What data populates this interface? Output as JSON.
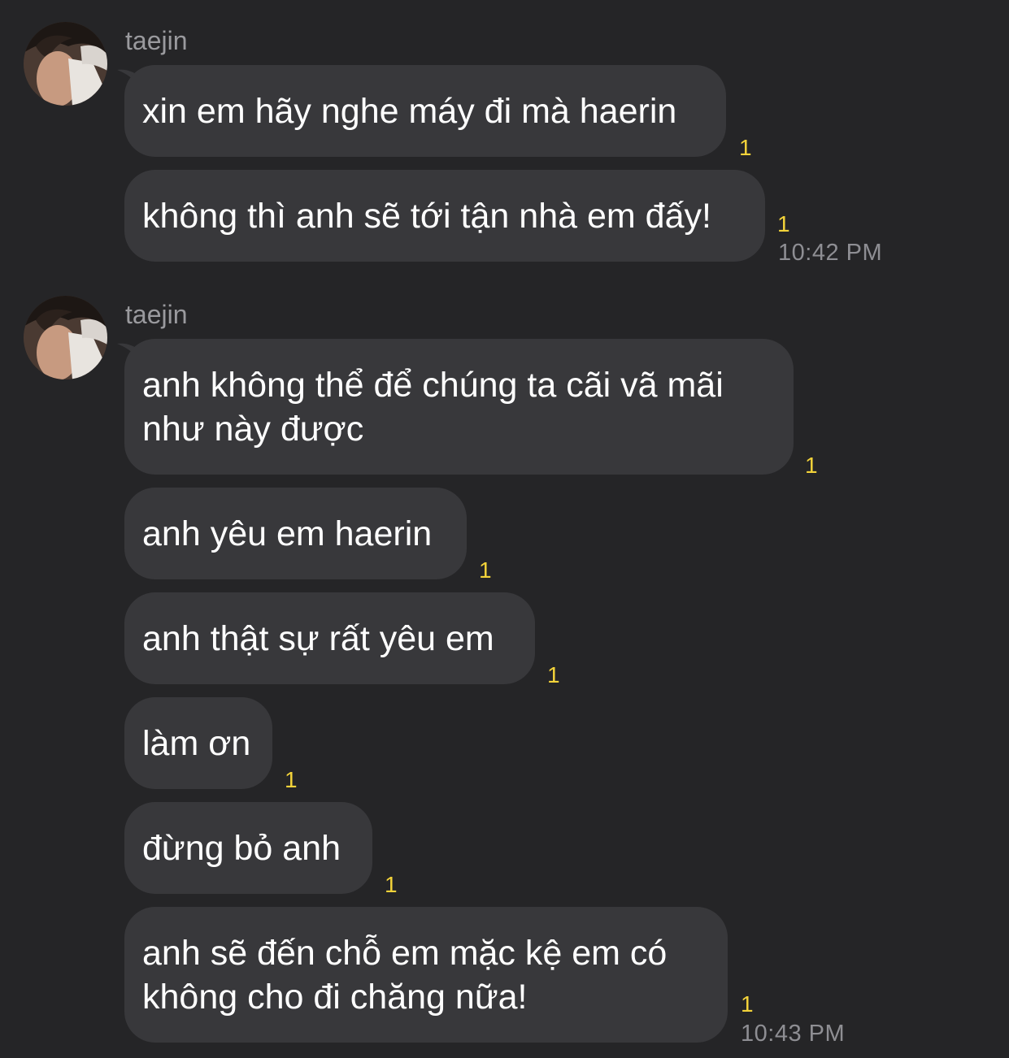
{
  "groups": [
    {
      "sender": "taejin",
      "time": "10:42 PM",
      "messages": [
        {
          "text": "xin em hãy nghe máy đi mà haerin",
          "unread": "1"
        },
        {
          "text": "không thì anh sẽ tới tận nhà em đấy!",
          "unread": "1"
        }
      ]
    },
    {
      "sender": "taejin",
      "time": "10:43 PM",
      "messages": [
        {
          "text": "anh không thể để chúng ta cãi vã mãi\nnhư này được",
          "unread": "1"
        },
        {
          "text": "anh yêu em haerin",
          "unread": "1"
        },
        {
          "text": "anh thật sự rất yêu em",
          "unread": "1"
        },
        {
          "text": "làm ơn",
          "unread": "1"
        },
        {
          "text": "đừng bỏ anh",
          "unread": "1"
        },
        {
          "text": "anh sẽ đến chỗ em mặc kệ em có\nkhông cho đi chăng nữa!",
          "unread": "1"
        }
      ]
    }
  ],
  "colors": {
    "background": "#252527",
    "bubble": "#38383b",
    "unread": "#f3d33a",
    "sender": "#9a9a9e",
    "time": "#8e8e93"
  },
  "icons": {
    "avatar": "profile-photo"
  }
}
